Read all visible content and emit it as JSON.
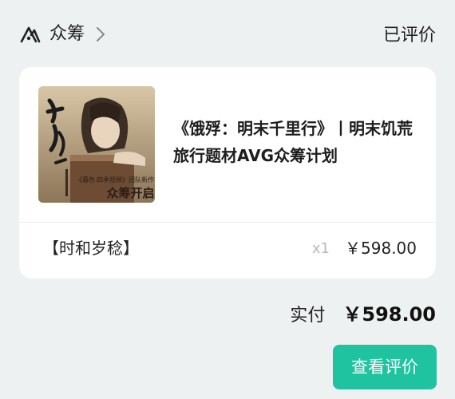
{
  "header": {
    "platform_name": "众筹",
    "status": "已评价"
  },
  "product": {
    "cover": {
      "title_calligraphy": "饿殍",
      "subtitle_calligraphy": "明末千里行",
      "credit_line": "《暮色 四季视频》团队新作",
      "badge": "众筹开启!"
    },
    "title": "《饿殍：明末千里行》丨明末饥荒旅行题材AVG众筹计划"
  },
  "sku": {
    "tier_name": "【时和岁稔】",
    "quantity": "x1",
    "price": "￥598.00"
  },
  "total": {
    "label": "实付",
    "amount": "￥598.00"
  },
  "actions": {
    "review_button": "查看评价"
  },
  "colors": {
    "background": "#eef1f1",
    "card": "#ffffff",
    "accent": "#1fc3a0",
    "muted_text": "#b8b8b8"
  },
  "icons": {
    "logo": "crowdfunding-mountain-icon",
    "chevron": "chevron-right-icon"
  }
}
